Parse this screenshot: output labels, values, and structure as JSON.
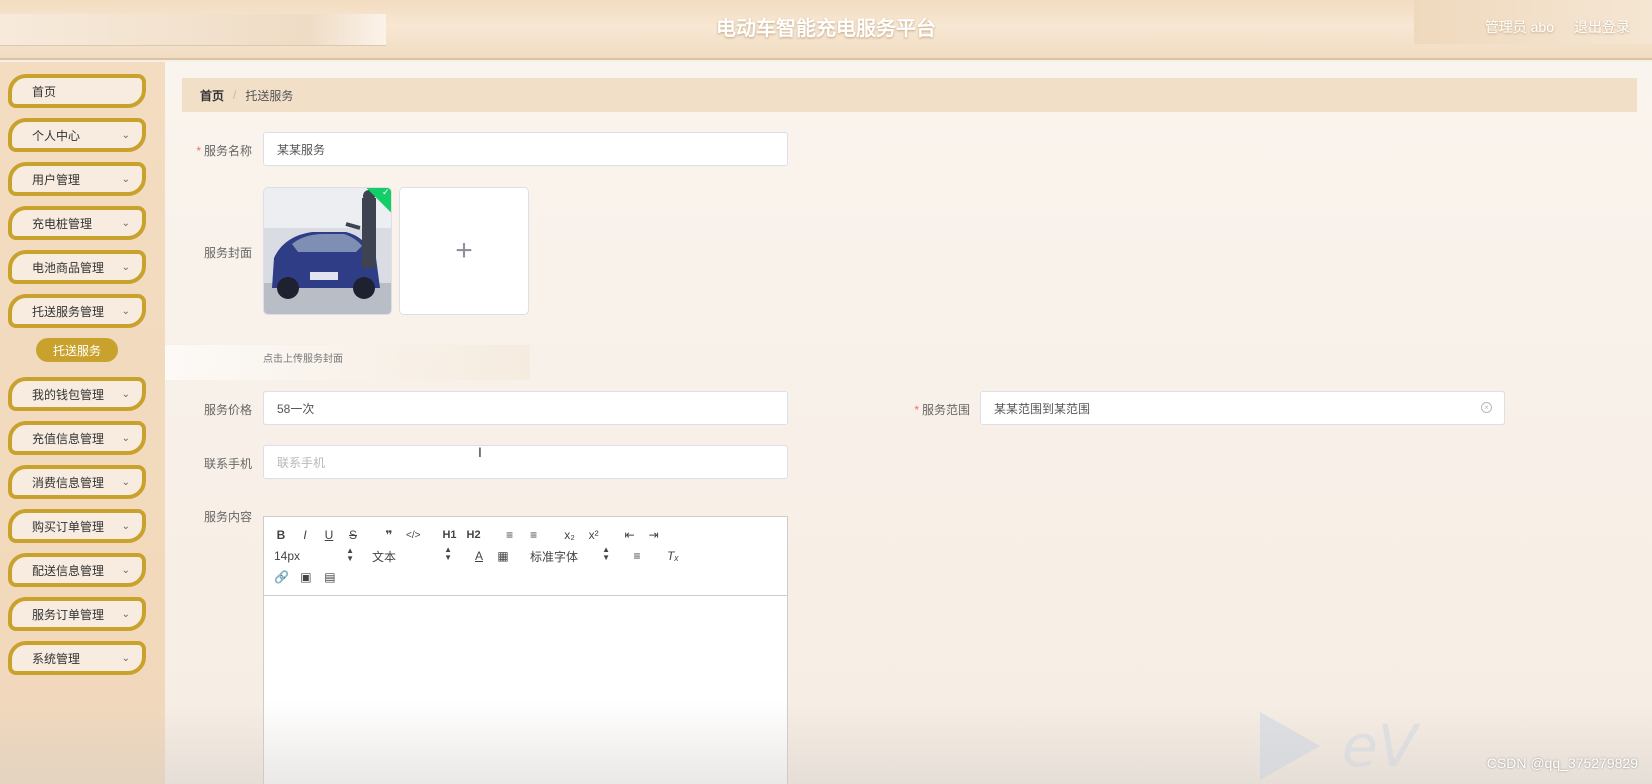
{
  "header": {
    "title": "电动车智能充电服务平台",
    "user": "管理员 abo",
    "logout": "退出登录"
  },
  "sidebar": {
    "items": [
      {
        "label": "首页",
        "has_children": false
      },
      {
        "label": "个人中心",
        "has_children": true
      },
      {
        "label": "用户管理",
        "has_children": true
      },
      {
        "label": "充电桩管理",
        "has_children": true
      },
      {
        "label": "电池商品管理",
        "has_children": true
      },
      {
        "label": "托送服务管理",
        "has_children": true
      },
      {
        "label": "我的钱包管理",
        "has_children": true
      },
      {
        "label": "充值信息管理",
        "has_children": true
      },
      {
        "label": "消费信息管理",
        "has_children": true
      },
      {
        "label": "购买订单管理",
        "has_children": true
      },
      {
        "label": "配送信息管理",
        "has_children": true
      },
      {
        "label": "服务订单管理",
        "has_children": true
      },
      {
        "label": "系统管理",
        "has_children": true
      }
    ],
    "active_submenu": "托送服务",
    "chevron": "chevron-down-icon"
  },
  "breadcrumb": {
    "home": "首页",
    "separator": "/",
    "current": "托送服务"
  },
  "form": {
    "name": {
      "label": "服务名称",
      "required": true,
      "value": "某某服务"
    },
    "cover": {
      "label": "服务封面",
      "tip": "点击上传服务封面",
      "add_icon": "plus-icon"
    },
    "price": {
      "label": "服务价格",
      "required": false,
      "value": "58一次"
    },
    "range": {
      "label": "服务范围",
      "required": true,
      "value": "某某范围到某范围"
    },
    "phone": {
      "label": "联系手机",
      "placeholder": "联系手机"
    },
    "content": {
      "label": "服务内容"
    }
  },
  "editor": {
    "row1": [
      "B",
      "I",
      "U",
      "S",
      "❞",
      "</>",
      "H1",
      "H2",
      "ol",
      "ul",
      "x₂",
      "x²",
      "outdent",
      "indent"
    ],
    "font_size": "14px",
    "header_select": "文本",
    "font_family": "标准字体"
  },
  "watermark": {
    "csdn": "CSDN @qq_375279829"
  },
  "colors": {
    "accent": "#c9a22e",
    "header_bg": "#f3dcc0",
    "success": "#13ce66",
    "required": "#f56c6c"
  }
}
